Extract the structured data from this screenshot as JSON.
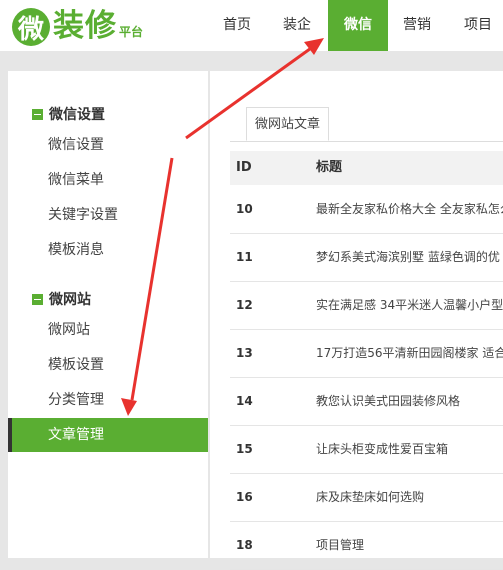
{
  "logo": {
    "mark": "微",
    "name": "装修",
    "suffix": "平台"
  },
  "nav": [
    {
      "label": "首页",
      "active": false
    },
    {
      "label": "装企",
      "active": false
    },
    {
      "label": "微信",
      "active": true
    },
    {
      "label": "营销",
      "active": false
    },
    {
      "label": "项目",
      "active": false
    }
  ],
  "sidebar": {
    "groups": [
      {
        "title": "微信设置",
        "items": [
          "微信设置",
          "微信菜单",
          "关键字设置",
          "模板消息"
        ]
      },
      {
        "title": "微网站",
        "items": [
          "微网站",
          "模板设置",
          "分类管理",
          "文章管理"
        ]
      }
    ],
    "active_item": "文章管理"
  },
  "content": {
    "tab_label": "微网站文章",
    "columns": {
      "id": "ID",
      "title": "标题"
    },
    "rows": [
      {
        "id": "10",
        "title": "最新全友家私价格大全 全友家私怎么"
      },
      {
        "id": "11",
        "title": "梦幻系美式海滨别墅 蓝绿色调的优"
      },
      {
        "id": "12",
        "title": "实在满足感 34平米迷人温馨小户型"
      },
      {
        "id": "13",
        "title": "17万打造56平清新田园阁楼家 适合"
      },
      {
        "id": "14",
        "title": "教您认识美式田园装修风格"
      },
      {
        "id": "15",
        "title": "让床头柜变成性爱百宝箱"
      },
      {
        "id": "16",
        "title": "床及床垫床如何选购"
      },
      {
        "id": "18",
        "title": "项目管理"
      }
    ]
  },
  "colors": {
    "accent": "#5aae32",
    "annotation_arrow": "#e8322e"
  }
}
